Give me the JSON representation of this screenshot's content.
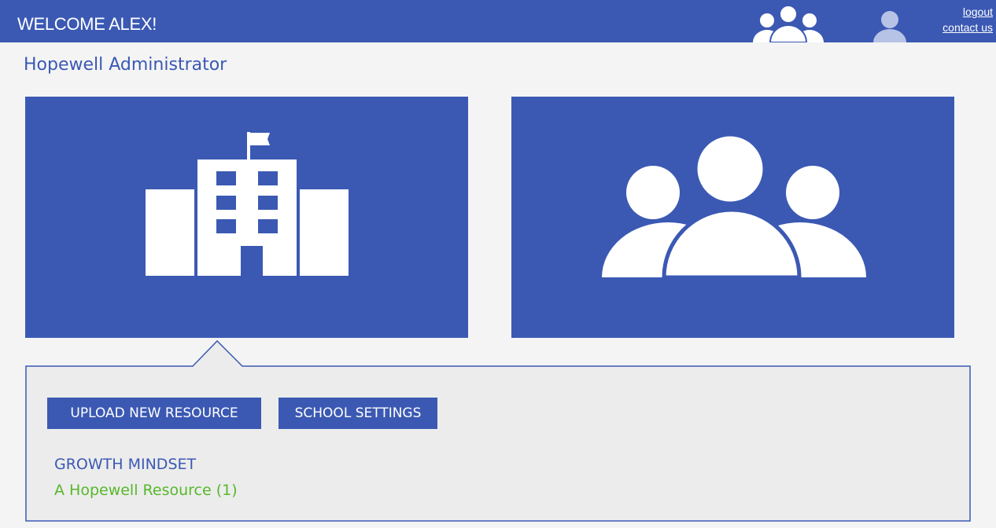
{
  "header": {
    "welcome": "WELCOME ALEX!",
    "logout": "logout",
    "contact": "contact us",
    "icons": [
      "group-icon",
      "user-icon"
    ],
    "bar_color": "#3b59b3"
  },
  "page": {
    "title": "Hopewell Administrator"
  },
  "tiles": [
    {
      "icon": "school-building-icon"
    },
    {
      "icon": "people-group-icon"
    }
  ],
  "panel": {
    "buttons": {
      "upload": "UPLOAD NEW RESOURCE",
      "settings": "SCHOOL SETTINGS"
    },
    "section_title": "GROWTH MINDSET",
    "resource": "A Hopewell Resource (1)"
  },
  "colors": {
    "accent": "#3b59b3",
    "link_green": "#56b82a",
    "background": "#f4f4f4",
    "panel_bg": "#ececec"
  }
}
